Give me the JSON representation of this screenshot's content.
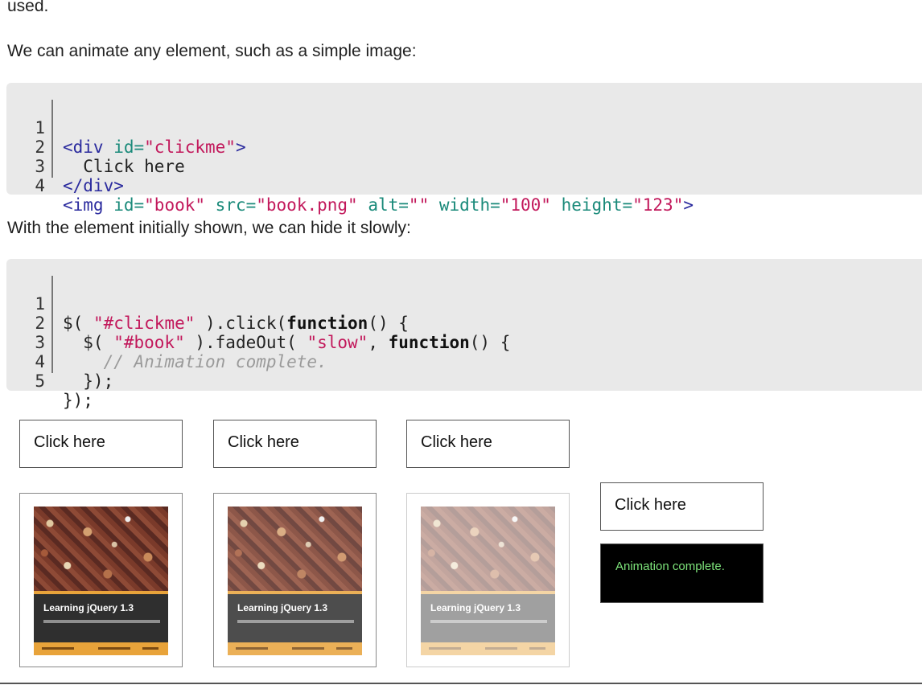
{
  "intro_fragment": "used.",
  "para_animate": "We can animate any element, such as a simple image:",
  "para_hide": "With the element initially shown, we can hide it slowly:",
  "code_html": {
    "line_numbers": [
      "1",
      "2",
      "3",
      "4"
    ],
    "l1_open": "<div ",
    "l1_attr": "id=",
    "l1_val": "\"clickme\"",
    "l1_close": ">",
    "l2_text": "  Click here",
    "l3_tag": "</div>",
    "l4_open": "<img ",
    "l4_a1": "id=",
    "l4_v1": "\"book\"",
    "l4_a2": "src=",
    "l4_v2": "\"book.png\"",
    "l4_a3": "alt=",
    "l4_v3": "\"\"",
    "l4_a4": "width=",
    "l4_v4": "\"100\"",
    "l4_a5": "height=",
    "l4_v5": "\"123\"",
    "l4_close": ">"
  },
  "code_js": {
    "line_numbers": [
      "1",
      "2",
      "3",
      "4",
      "5"
    ],
    "l1_a": "$( ",
    "l1_str": "\"#clickme\"",
    "l1_b": " ).click(",
    "l1_kw": "function",
    "l1_c": "() {",
    "l2_a": "  $( ",
    "l2_str": "\"#book\"",
    "l2_b": " ).fadeOut( ",
    "l2_str2": "\"slow\"",
    "l2_c": ", ",
    "l2_kw": "function",
    "l2_d": "() {",
    "l3_cmt": "    // Animation complete.",
    "l4_text": "  });",
    "l5_text": "});"
  },
  "demo": {
    "button_label": "Click here",
    "book_title": "Learning jQuery 1.3",
    "status_text": "Animation complete.",
    "fade_steps": [
      1,
      0.85,
      0.45
    ]
  },
  "colors": {
    "code_bg": "#e9e9e9",
    "status_text": "#7de37a",
    "book_accent": "#e8a33a"
  }
}
